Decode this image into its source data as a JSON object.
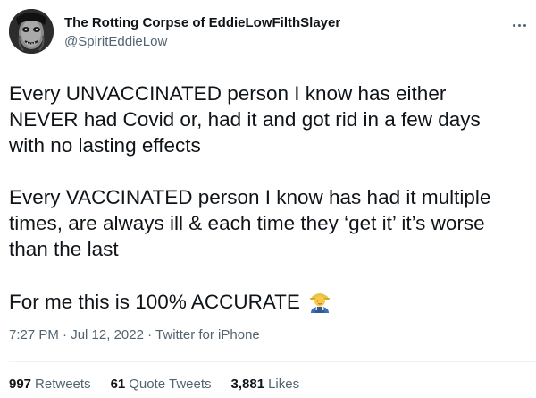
{
  "author": {
    "display_name": "The Rotting Corpse of EddieLowFilthSlayer",
    "handle": "@SpiritEddieLow",
    "avatar_icon": "zombie-face-avatar"
  },
  "tweet": {
    "paragraphs": [
      [
        "Every UNVACCINATED person I know has either",
        "NEVER had Covid or, had it and got rid in a few days",
        "with no lasting effects"
      ],
      [
        "Every VACCINATED person I know has had it multiple",
        "times, are always ill & each time they ‘get it’ it’s worse",
        "than the last"
      ]
    ],
    "final_line": "For me this is 100% ACCURATE",
    "emoji": "man-farmer-emoji"
  },
  "meta": {
    "time": "7:27 PM",
    "separator": "·",
    "date": "Jul 12, 2022",
    "source": "Twitter for iPhone"
  },
  "stats": {
    "retweets_count": "997",
    "retweets_label": "Retweets",
    "quotes_count": "61",
    "quotes_label": "Quote Tweets",
    "likes_count": "3,881",
    "likes_label": "Likes"
  },
  "colors": {
    "text": "#0f1419",
    "secondary": "#536471",
    "divider": "#eff3f4"
  }
}
